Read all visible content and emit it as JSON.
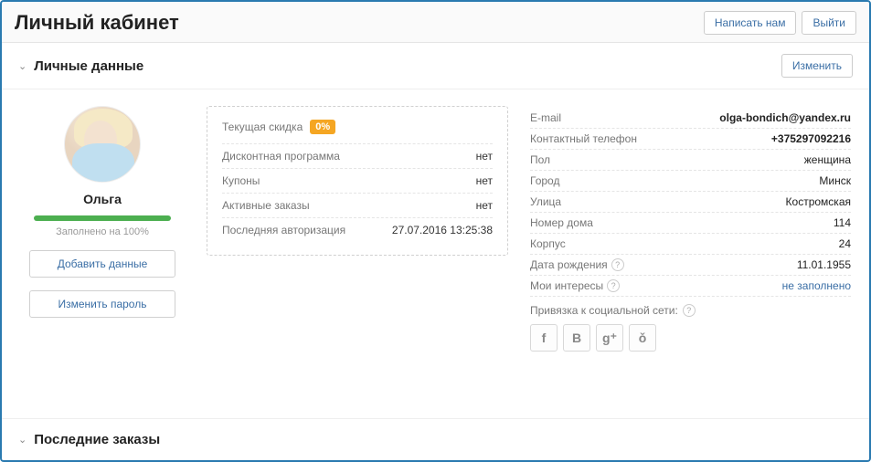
{
  "header": {
    "title": "Личный кабинет",
    "write_us": "Написать нам",
    "logout": "Выйти"
  },
  "section_personal": {
    "title": "Личные данные",
    "edit_button": "Изменить"
  },
  "profile": {
    "name": "Ольга",
    "progress_text": "Заполнено на 100%",
    "progress_percent": 100,
    "add_data_button": "Добавить данные",
    "change_password_button": "Изменить пароль"
  },
  "discount_box": {
    "current_discount_label": "Текущая скидка",
    "current_discount_value": "0%",
    "rows": [
      {
        "label": "Дисконтная программа",
        "value": "нет"
      },
      {
        "label": "Купоны",
        "value": "нет"
      },
      {
        "label": "Активные заказы",
        "value": "нет"
      },
      {
        "label": "Последняя авторизация",
        "value": "27.07.2016 13:25:38"
      }
    ]
  },
  "fields": {
    "email": {
      "label": "E-mail",
      "value": "olga-bondich@yandex.ru"
    },
    "phone": {
      "label": "Контактный телефон",
      "value": "+375297092216"
    },
    "gender": {
      "label": "Пол",
      "value": "женщина"
    },
    "city": {
      "label": "Город",
      "value": "Минск"
    },
    "street": {
      "label": "Улица",
      "value": "Костромская"
    },
    "house": {
      "label": "Номер дома",
      "value": "114"
    },
    "block": {
      "label": "Корпус",
      "value": "24"
    },
    "dob": {
      "label": "Дата рождения",
      "value": "11.01.1955"
    },
    "interests": {
      "label": "Мои интересы",
      "value": "не заполнено"
    }
  },
  "social": {
    "label": "Привязка к социальной сети:",
    "networks": [
      {
        "id": "facebook",
        "glyph": "f"
      },
      {
        "id": "vkontakte",
        "glyph": "B"
      },
      {
        "id": "google-plus",
        "glyph": "g⁺"
      },
      {
        "id": "odnoklassniki",
        "glyph": "ǒ"
      }
    ]
  },
  "section_orders": {
    "title": "Последние заказы"
  }
}
